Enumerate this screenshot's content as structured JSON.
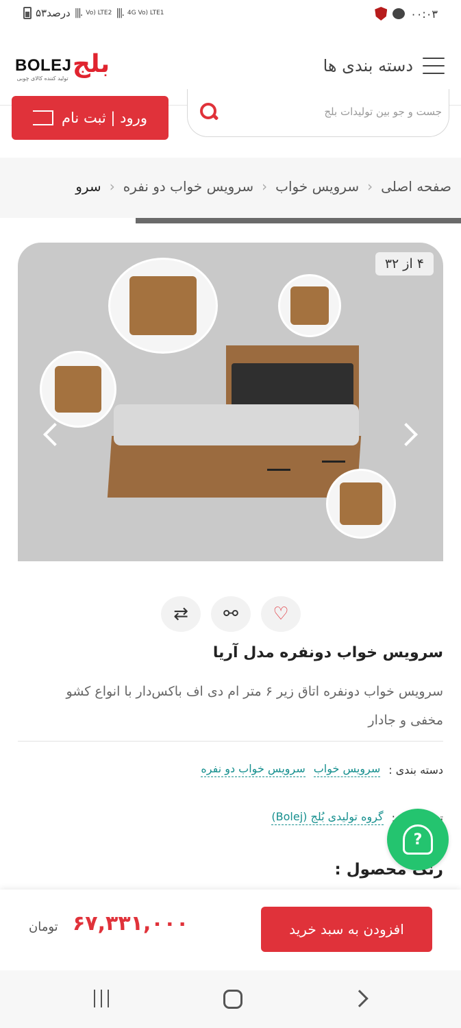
{
  "status_bar": {
    "battery_text": "۵۳درصد",
    "signal_1_label": "Vo) LTE2",
    "signal_2_label": "4G Vo) LTE1",
    "time": "۰۰:۰۳"
  },
  "header": {
    "menu_label": "دسته بندی ها",
    "logo_text": "BOLEJ",
    "logo_mark": "بلج",
    "logo_subtitle": "تولید کننده کالای چوبی"
  },
  "search": {
    "placeholder": "جست و جو بین تولیدات بلج",
    "login_label": "ورود | ثبت نام"
  },
  "breadcrumb": {
    "items": [
      "صفحه اصلی",
      "سرویس خواب",
      "سرویس خواب دو نفره",
      "سرو"
    ]
  },
  "gallery": {
    "counter": "۴ از ۳۲"
  },
  "product": {
    "title": "سرویس خواب دونفره مدل آریا",
    "description": "سرویس خواب دونفره اتاق زیر ۶ متر ام دی اف باکس‌دار با انواع کشو مخفی و جادار",
    "category_label": "دسته بندی :",
    "categories": [
      "سرویس خواب",
      "سرویس خواب دو نفره"
    ],
    "producer_label": "تولیدکننده :",
    "producer": "گروه تولیدی بُلج (Bolej)",
    "color_label": "رنگ محصول :"
  },
  "buy_bar": {
    "add_to_cart": "افزودن به سبد خرید",
    "price": "۶۷,۳۳۱,۰۰۰",
    "currency": "تومان"
  },
  "colors": {
    "brand_red": "#e0323a",
    "link_teal": "#17908f",
    "support_green": "#24c46f"
  }
}
